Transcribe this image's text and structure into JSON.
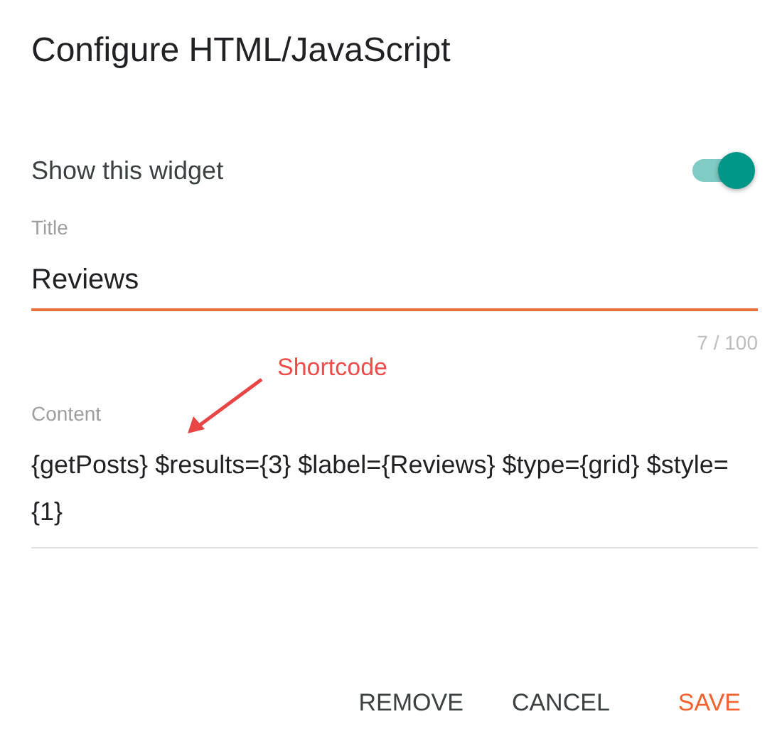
{
  "dialog": {
    "title": "Configure HTML/JavaScript"
  },
  "show_widget": {
    "label": "Show this widget",
    "on": true
  },
  "title_field": {
    "label": "Title",
    "value": "Reviews",
    "counter": "7 / 100",
    "focused": true
  },
  "annotation": {
    "text": "Shortcode"
  },
  "content_field": {
    "label": "Content",
    "value": "{getPosts} $results={3} $label={Reviews} $type={grid} $style={1}"
  },
  "buttons": [
    {
      "label": "REMOVE",
      "kind": "default"
    },
    {
      "label": "CANCEL",
      "kind": "default"
    },
    {
      "label": "SAVE",
      "kind": "primary"
    }
  ]
}
